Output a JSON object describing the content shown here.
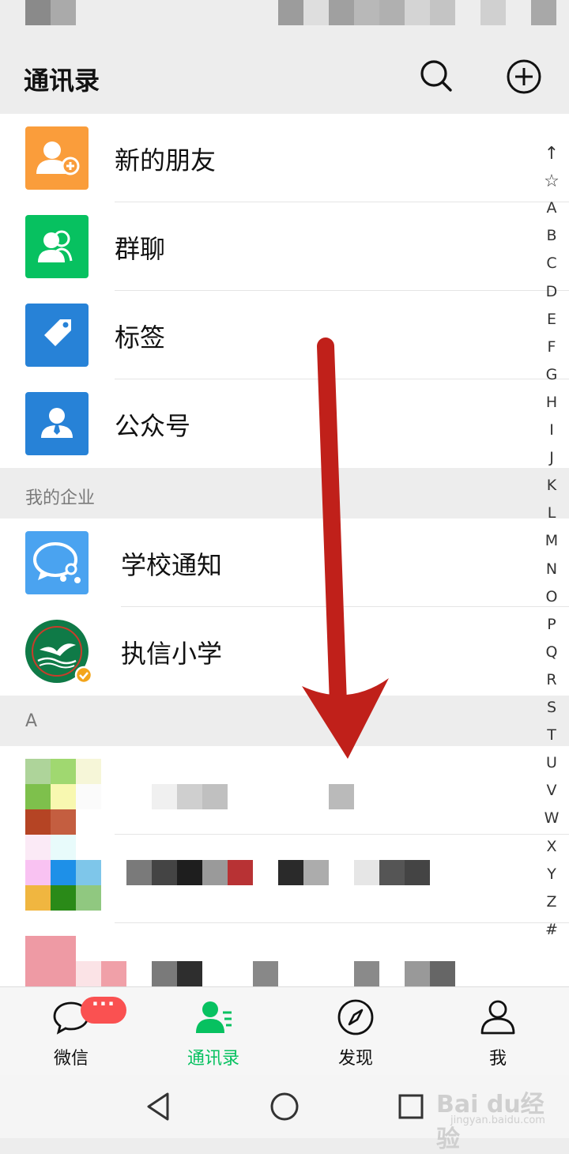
{
  "header": {
    "title": "通讯录"
  },
  "menu": {
    "new_friends": "新的朋友",
    "group_chat": "群聊",
    "tags": "标签",
    "official_accounts": "公众号"
  },
  "sections": {
    "my_enterprise": "我的企业",
    "letter_a": "A"
  },
  "enterprise": {
    "school_notice": "学校通知",
    "school": "执信小学"
  },
  "index_letters": [
    "↑",
    "☆",
    "A",
    "B",
    "C",
    "D",
    "E",
    "F",
    "G",
    "H",
    "I",
    "J",
    "K",
    "L",
    "M",
    "N",
    "O",
    "P",
    "Q",
    "R",
    "S",
    "T",
    "U",
    "V",
    "W",
    "X",
    "Y",
    "Z",
    "#"
  ],
  "tabs": [
    {
      "label": "微信",
      "icon": "chat-bubble-icon"
    },
    {
      "label": "通讯录",
      "icon": "contacts-icon"
    },
    {
      "label": "发现",
      "icon": "compass-icon"
    },
    {
      "label": "我",
      "icon": "person-icon"
    }
  ],
  "badge": {
    "text": "···"
  },
  "watermark": {
    "main": "Bai du经验",
    "sub": "jingyan.baidu.com"
  },
  "colors": {
    "accent": "#07c160",
    "badge": "#fa5151",
    "arrow": "#c0201a",
    "orange": "#fa9d3b",
    "blue": "#2782d7"
  }
}
